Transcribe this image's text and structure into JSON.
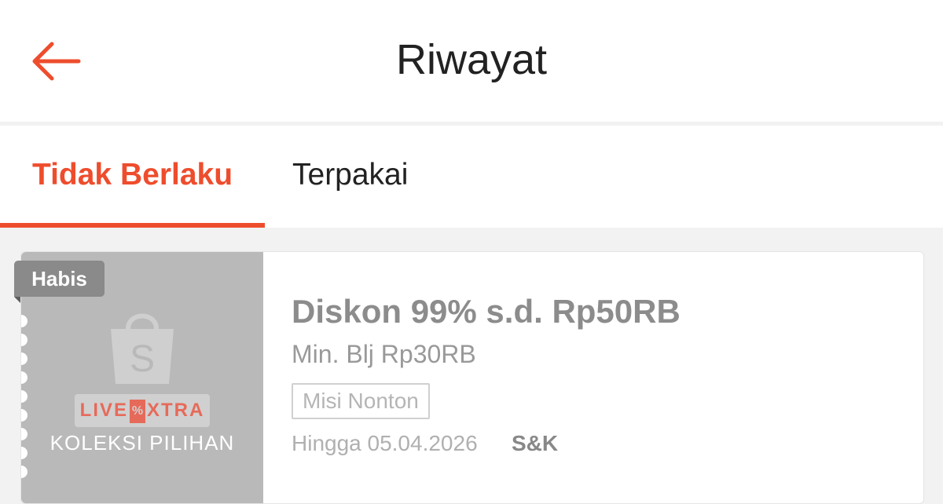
{
  "header": {
    "title": "Riwayat",
    "back_icon": "arrow-left-icon",
    "accent_color": "#ee4d2d"
  },
  "tabs": [
    {
      "label": "Tidak Berlaku",
      "active": true
    },
    {
      "label": "Terpakai",
      "active": false
    }
  ],
  "voucher": {
    "badge": "Habis",
    "logo_icon": "shopee-bag-icon",
    "campaign": {
      "prefix": "LIVE",
      "symbol": "%",
      "suffix": "XTRA"
    },
    "collection_label": "KOLEKSI PILIHAN",
    "title": "Diskon 99% s.d. Rp50RB",
    "min_purchase": "Min. Blj Rp30RB",
    "tag": "Misi Nonton",
    "expiry": "Hingga 05.04.2026",
    "terms_link": "S&K"
  }
}
